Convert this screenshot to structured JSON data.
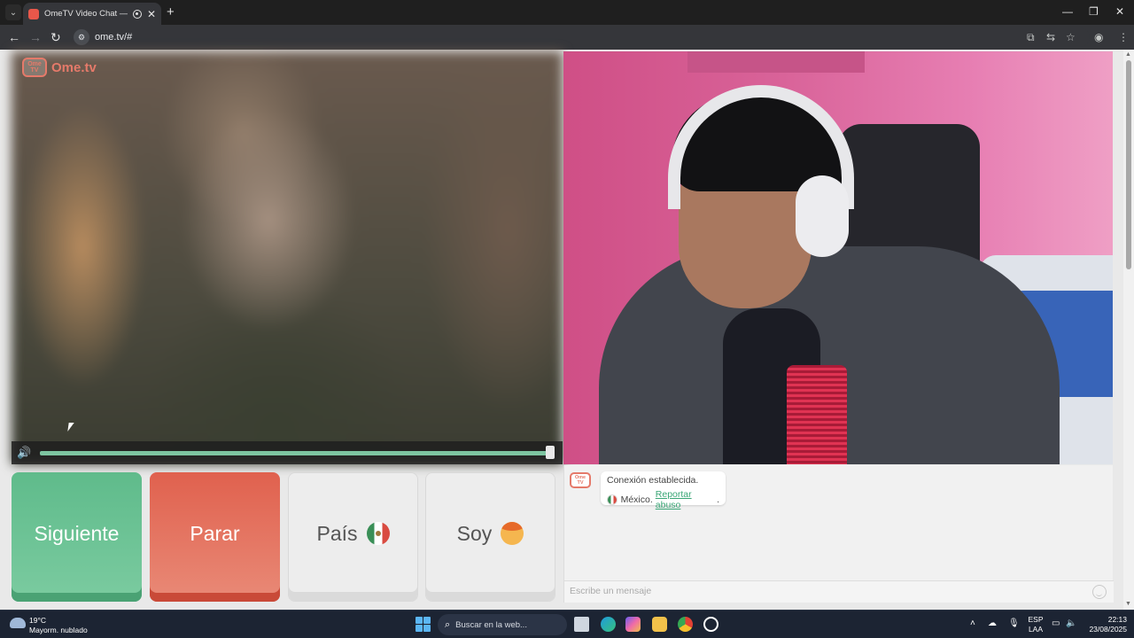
{
  "browser": {
    "tab_title": "OmeTV Video Chat — Ome",
    "tab_close": "✕",
    "new_tab": "+",
    "url": "ome.tv/#",
    "window_controls": {
      "minimize": "—",
      "maximize": "❐",
      "close": "✕"
    }
  },
  "page": {
    "logo_text": "Ome.tv",
    "logo_badge": "Ome TV",
    "volume_percent": 100,
    "buttons": {
      "next": "Siguiente",
      "stop": "Parar",
      "country": "País",
      "gender": "Soy"
    },
    "chat": {
      "logo_badge": "Ome TV",
      "system_message": "Conexión establecida.",
      "country": "México.",
      "report_link": "Reportar abuso",
      "report_suffix": ".",
      "input_placeholder": "Escribe un mensaje"
    },
    "colors": {
      "next_button": "#5fbb8b",
      "stop_button": "#e0614e",
      "accent_link": "#3aa676",
      "brand": "#e57a6a"
    }
  },
  "taskbar": {
    "weather_temp": "19°C",
    "weather_desc": "Mayorm. nublado",
    "search_placeholder": "Buscar en la web...",
    "language_top": "ESP",
    "language_bottom": "LAA",
    "time": "22:13",
    "date": "23/08/2025"
  }
}
